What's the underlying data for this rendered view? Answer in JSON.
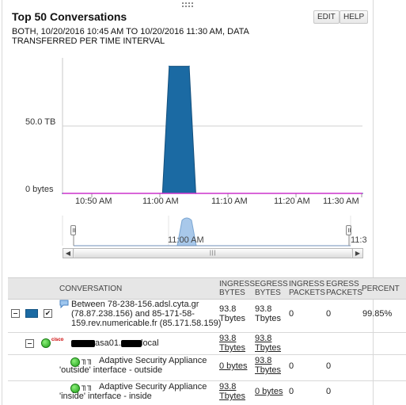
{
  "widget": {
    "title": "Top 50 Conversations",
    "subtitle": "BOTH, 10/20/2016 10:45 AM TO 10/20/2016 11:30 AM, DATA TRANSFERRED PER TIME INTERVAL",
    "edit_label": "EDIT",
    "help_label": "HELP"
  },
  "chart_data": {
    "type": "area",
    "title": "",
    "xlabel": "",
    "ylabel": "",
    "x_ticks": [
      "10:50 AM",
      "11:00 AM",
      "11:10 AM",
      "11:20 AM",
      "11:30 AM"
    ],
    "y_ticks": [
      "0 bytes",
      "50.0 TB"
    ],
    "ylim_tb": [
      0,
      93.8
    ],
    "series": [
      {
        "color": "#1b6aa3",
        "points": [
          {
            "t": "10:45 AM",
            "tb": 0
          },
          {
            "t": "11:00 AM",
            "tb": 0
          },
          {
            "t": "11:01 AM",
            "tb": 88
          },
          {
            "t": "11:04 AM",
            "tb": 88
          },
          {
            "t": "11:05 AM",
            "tb": 0
          },
          {
            "t": "11:30 AM",
            "tb": 0
          }
        ]
      }
    ],
    "baseline_color": "#cc33cc",
    "grid": true
  },
  "navigator": {
    "label_1": "11:00 AM",
    "label_2": "11:3"
  },
  "table": {
    "headers": {
      "conversation": "CONVERSATION",
      "ingress_bytes": "INGRESS BYTES",
      "egress_bytes": "EGRESS BYTES",
      "ingress_packets": "INGRESS PACKETS",
      "egress_packets": "EGRESS PACKETS",
      "percent": "PERCENT"
    },
    "rows": [
      {
        "text": "Between 78-238-156.adsl.cyta.gr (78.87.238.156) and 85-171-58-159.rev.numericable.fr (85.171.58.159)",
        "ingress_bytes": "93.8 Tbytes",
        "egress_bytes": "93.8 Tbytes",
        "ingress_packets": "0",
        "egress_packets": "0",
        "percent": "99.85%",
        "checkbox": "✔"
      },
      {
        "text_mid": "asa01.",
        "text_end": "local",
        "vendor": "cisco",
        "ingress_bytes": "93.8 Tbytes",
        "egress_bytes": "93.8 Tbytes"
      },
      {
        "text": "Adaptive Security Appliance 'outside' interface - outside",
        "ingress_bytes": "0 bytes",
        "egress_bytes": "93.8 Tbytes",
        "ingress_packets": "0",
        "egress_packets": "0"
      },
      {
        "text": "Adaptive Security Appliance 'inside' interface - inside",
        "ingress_bytes": "93.8 Tbytes",
        "egress_bytes": "0 bytes",
        "ingress_packets": "0",
        "egress_packets": "0"
      }
    ]
  }
}
